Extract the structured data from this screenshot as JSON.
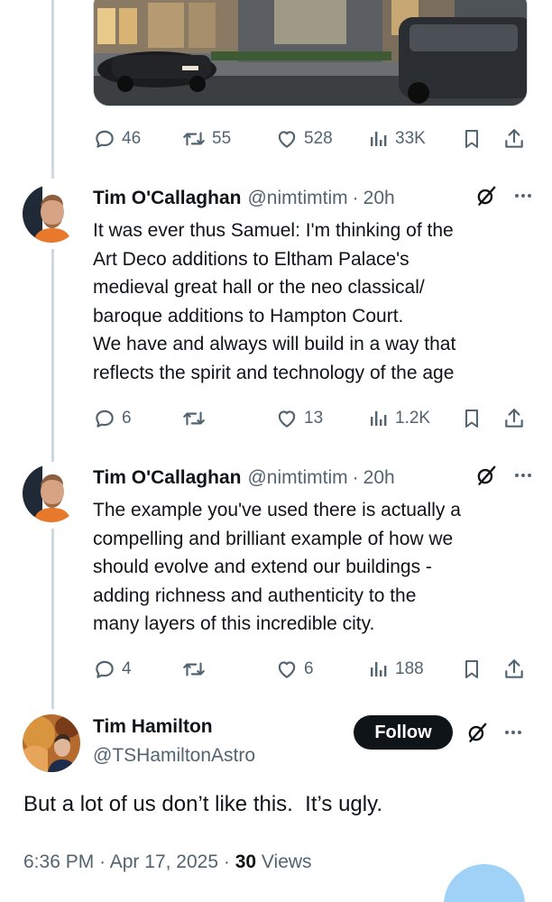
{
  "tweets": [
    {
      "stats": {
        "replies": "46",
        "retweets": "55",
        "likes": "528",
        "views": "33K"
      }
    },
    {
      "name": "Tim O'Callaghan",
      "handle": "@nimtimtim",
      "dot": "·",
      "time": "20h",
      "lines": [
        "It was ever thus Samuel: I'm thinking of the",
        "Art Deco additions to Eltham Palace's",
        "medieval great hall or the neo classical/",
        "baroque additions to Hampton Court.",
        "We have and always will build in a way that",
        "reflects the spirit and technology of the age"
      ],
      "stats": {
        "replies": "6",
        "retweets": "",
        "likes": "13",
        "views": "1.2K"
      }
    },
    {
      "name": "Tim O'Callaghan",
      "handle": "@nimtimtim",
      "dot": "·",
      "time": "20h",
      "lines": [
        "The example you've used there is actually a",
        "compelling and brilliant example of how we",
        "should evolve and extend our buildings -",
        "adding richness and authenticity to the",
        "many layers of this incredible city."
      ],
      "stats": {
        "replies": "4",
        "retweets": "",
        "likes": "6",
        "views": "188"
      }
    }
  ],
  "main": {
    "name": "Tim Hamilton",
    "handle": "@TSHamiltonAstro",
    "follow_label": "Follow",
    "text": "But a lot of us don’t like this.  It’s ugly.",
    "time": "6:36 PM",
    "date": "Apr 17, 2025",
    "views_count": "30",
    "views_label": "Views",
    "sep": "·"
  },
  "icons": {
    "reply": "reply-icon",
    "retweet": "retweet-icon",
    "like": "heart-icon",
    "views": "views-icon",
    "bookmark": "bookmark-icon",
    "share": "share-icon",
    "grok": "grok-icon",
    "more": "more-icon",
    "compose": "compose-icon"
  },
  "colors": {
    "text": "#0f1419",
    "secondary": "#536471",
    "line": "#cfd9de",
    "follow_bg": "#0f1419",
    "fab": "#8fc9f5"
  }
}
